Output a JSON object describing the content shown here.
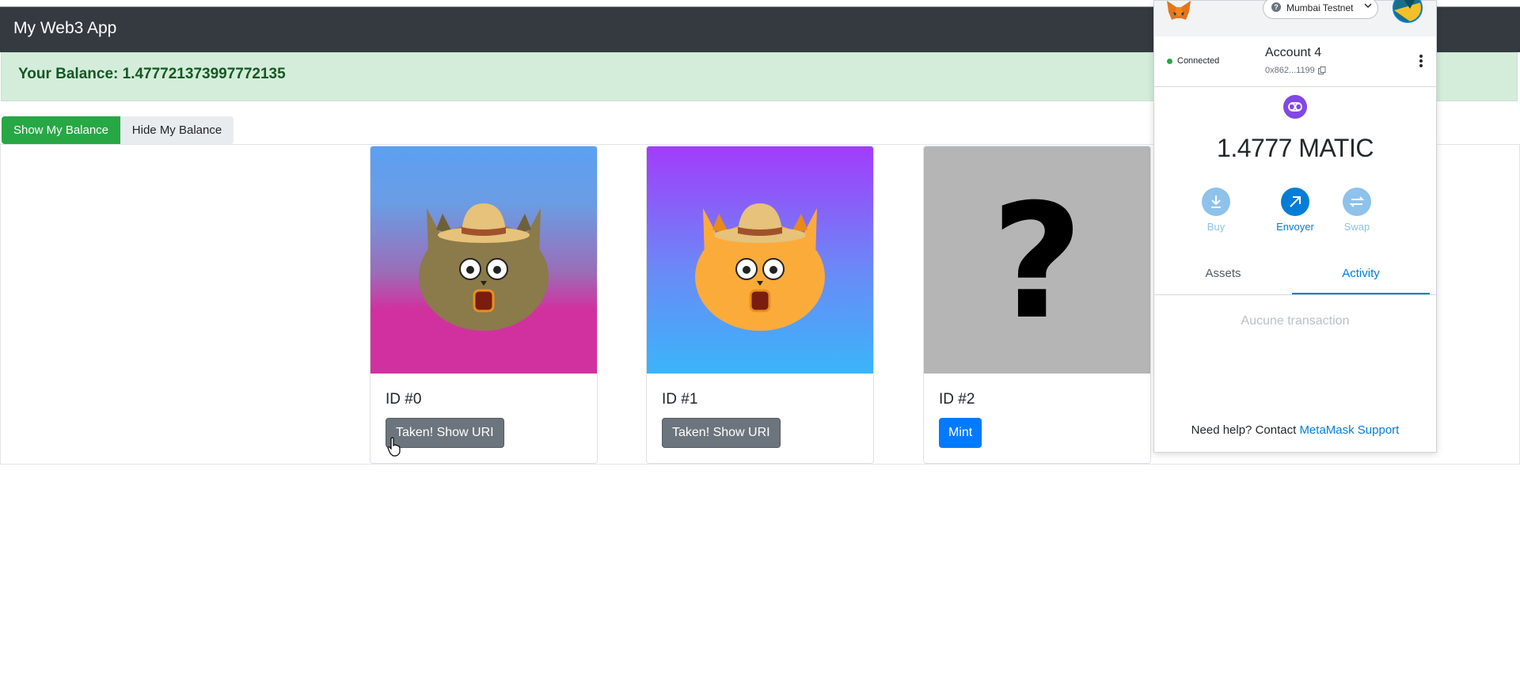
{
  "app": {
    "title": "My Web3 App",
    "balance_text": "Your Balance: 1.477721373997772135",
    "show_balance_label": "Show My Balance",
    "hide_balance_label": "Hide My Balance"
  },
  "cards": [
    {
      "id_label": "ID #0",
      "button_label": "Taken! Show URI",
      "button_type": "taken",
      "image": "cowboy-cat-olive",
      "gradient": [
        "#5c9ff2",
        "#d1319f"
      ]
    },
    {
      "id_label": "ID #1",
      "button_label": "Taken! Show URI",
      "button_type": "taken",
      "image": "cowboy-cat-orange",
      "gradient": [
        "#a23cfa",
        "#3ab5fa"
      ]
    },
    {
      "id_label": "ID #2",
      "button_label": "Mint",
      "button_type": "mint",
      "image": "question-mark",
      "gradient": [
        "#b5b5b5",
        "#b5b5b5"
      ]
    }
  ],
  "metamask": {
    "network": "Mumbai Testnet",
    "connection_status": "Connected",
    "account_name": "Account 4",
    "account_address": "0x862...1199",
    "balance": "1.4777 MATIC",
    "actions": [
      {
        "label": "Buy",
        "icon": "download-icon",
        "enabled": false
      },
      {
        "label": "Envoyer",
        "icon": "arrow-up-right-icon",
        "enabled": true
      },
      {
        "label": "Swap",
        "icon": "swap-icon",
        "enabled": false
      }
    ],
    "tabs": {
      "assets": "Assets",
      "activity": "Activity",
      "active": "Activity"
    },
    "empty_activity": "Aucune transaction",
    "help_text": "Need help? Contact ",
    "help_link": "MetaMask Support"
  },
  "colors": {
    "navbar": "#343a40",
    "alert_bg": "#d4edda",
    "alert_text": "#155724",
    "success": "#28a745",
    "secondary": "#6c757d",
    "primary": "#007bff",
    "metamask_blue": "#037dd6",
    "matic_purple": "#8247e5"
  }
}
